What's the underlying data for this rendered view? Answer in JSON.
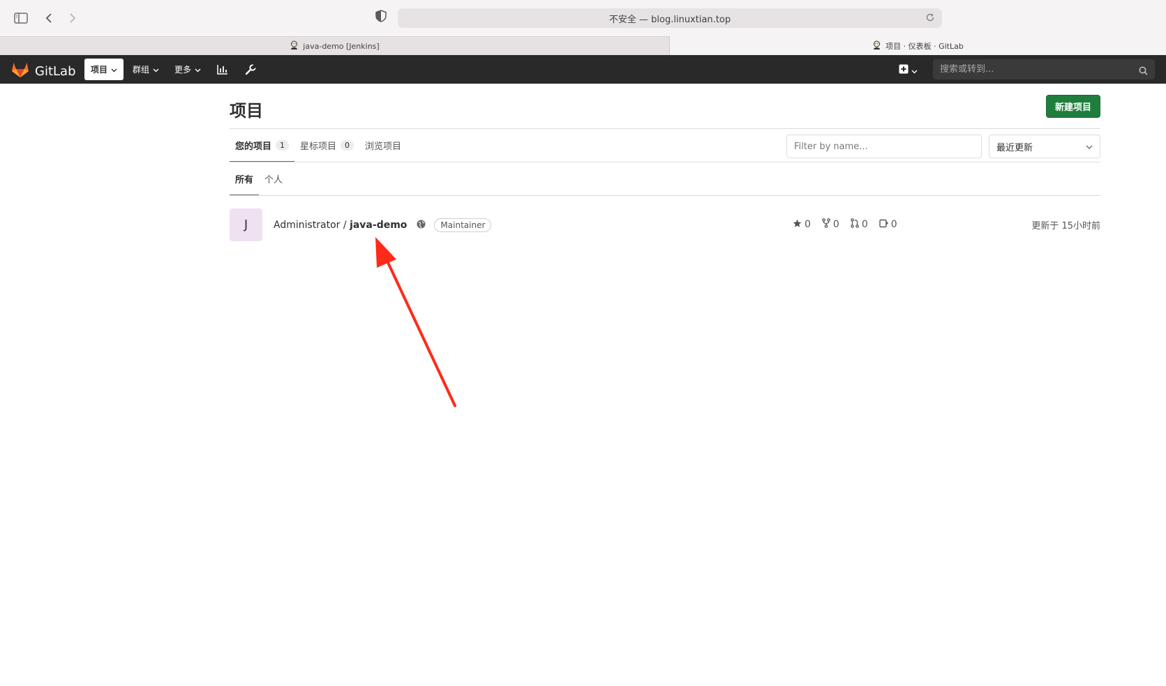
{
  "browser": {
    "url_text": "不安全 — blog.linuxtian.top",
    "tabs": [
      {
        "label": "java-demo [Jenkins]",
        "icon": "jenkins-icon",
        "active": false
      },
      {
        "label": "项目 · 仪表板 · GitLab",
        "icon": "jenkins-icon",
        "active": true
      }
    ]
  },
  "navbar": {
    "brand": "GitLab",
    "brand_color": "#fc6d26",
    "items": [
      {
        "label": "项目",
        "active": true
      },
      {
        "label": "群组",
        "active": false
      },
      {
        "label": "更多",
        "active": false
      }
    ],
    "icons": [
      "chart-icon",
      "wrench-icon"
    ],
    "search_placeholder": "搜索或转到..."
  },
  "page": {
    "title": "项目",
    "new_button": "新建项目",
    "new_button_color": "#1f7e3d",
    "tabs": [
      {
        "label": "您的项目",
        "count": "1",
        "active": true
      },
      {
        "label": "星标项目",
        "count": "0",
        "active": false
      },
      {
        "label": "浏览项目",
        "count": null,
        "active": false
      }
    ],
    "filter_placeholder": "Filter by name...",
    "sort_value": "最近更新",
    "subtabs": [
      {
        "label": "所有",
        "active": true
      },
      {
        "label": "个人",
        "active": false
      }
    ]
  },
  "projects": [
    {
      "avatar_letter": "J",
      "avatar_color": "#f0e1f2",
      "namespace": "Administrator / ",
      "name": "java-demo",
      "visibility_icon": "globe-icon",
      "role": "Maintainer",
      "stars": "0",
      "forks": "0",
      "merge_requests": "0",
      "issues": "0",
      "updated": "更新于 15小时前"
    }
  ],
  "annotation": {
    "arrow_color": "#ff2a1a"
  }
}
